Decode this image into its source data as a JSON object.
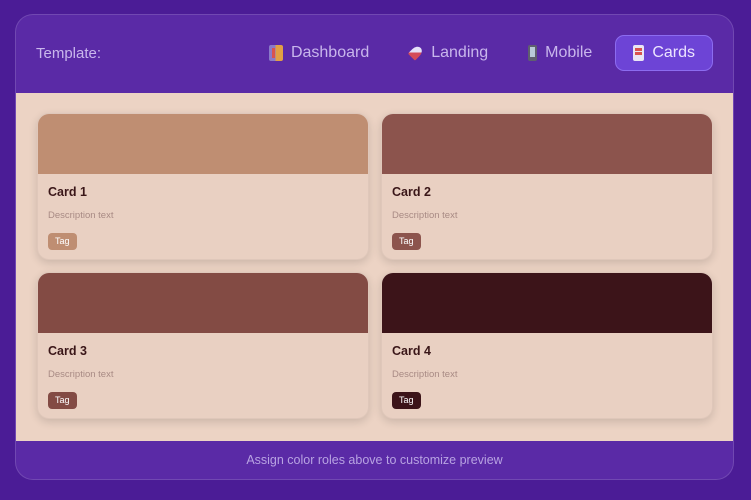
{
  "toolbar": {
    "label": "Template:",
    "tabs": [
      {
        "label": "Dashboard",
        "icon": "dashboard-icon",
        "active": false
      },
      {
        "label": "Landing",
        "icon": "rocket-icon",
        "active": false
      },
      {
        "label": "Mobile",
        "icon": "mobile-phone-icon",
        "active": false
      },
      {
        "label": "Cards",
        "icon": "cards-icon",
        "active": true
      }
    ]
  },
  "cards": [
    {
      "title": "Card 1",
      "description": "Description text",
      "tag": "Tag",
      "color": "#bf8e72"
    },
    {
      "title": "Card 2",
      "description": "Description text",
      "tag": "Tag",
      "color": "#8c544d"
    },
    {
      "title": "Card 3",
      "description": "Description text",
      "tag": "Tag",
      "color": "#834b44"
    },
    {
      "title": "Card 4",
      "description": "Description text",
      "tag": "Tag",
      "color": "#3c1419"
    }
  ],
  "footer": {
    "text": "Assign color roles above to customize preview"
  },
  "colors": {
    "background": "#4b1c96",
    "panel": "#5a2aa6",
    "active_tab": "#6d44d6",
    "preview_bg": "#ecd3c4"
  }
}
